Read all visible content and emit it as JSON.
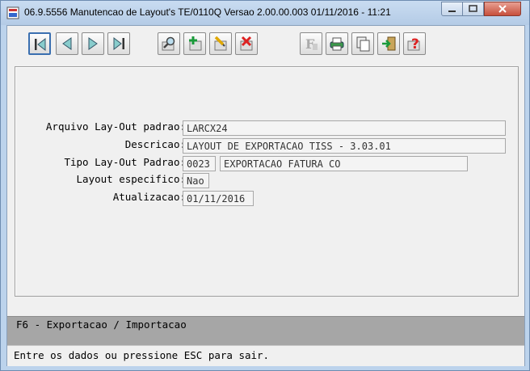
{
  "window": {
    "title": "06.9.5556 Manutencao  de Layout's TE/0110Q Versao 2.00.00.003 01/11/2016 - 11:21"
  },
  "toolbar": {
    "buttons": [
      {
        "name": "first-record",
        "icon": "first-icon"
      },
      {
        "name": "previous-record",
        "icon": "previous-icon"
      },
      {
        "name": "next-record",
        "icon": "next-icon"
      },
      {
        "name": "last-record",
        "icon": "last-icon"
      },
      {
        "name": "search",
        "icon": "magnifier-icon"
      },
      {
        "name": "insert",
        "icon": "plus-icon"
      },
      {
        "name": "edit",
        "icon": "pencil-icon"
      },
      {
        "name": "delete",
        "icon": "x-icon"
      },
      {
        "name": "function",
        "icon": "f-icon"
      },
      {
        "name": "print",
        "icon": "printer-icon"
      },
      {
        "name": "copy",
        "icon": "copy-icon"
      },
      {
        "name": "exit",
        "icon": "door-icon"
      },
      {
        "name": "help",
        "icon": "help-icon"
      }
    ]
  },
  "form": {
    "arquivo_label": "Arquivo Lay-Out padrao:",
    "arquivo_value": "LARCX24",
    "descricao_label": "Descricao:",
    "descricao_value": "LAYOUT DE EXPORTACAO TISS - 3.03.01",
    "tipo_label": "Tipo Lay-Out Padrao:",
    "tipo_code": "0023",
    "tipo_desc": "EXPORTACAO FATURA CO",
    "especifico_label": "Layout especifico:",
    "especifico_value": "Nao",
    "atualizacao_label": "Atualizacao:",
    "atualizacao_value": "01/11/2016"
  },
  "function_bar": {
    "text": "F6 - Exportacao / Importacao"
  },
  "status_bar": {
    "text": "Entre os dados ou pressione ESC para sair."
  }
}
